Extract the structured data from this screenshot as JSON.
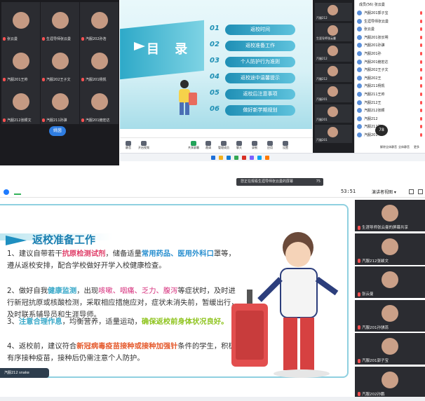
{
  "top": {
    "gallery": [
      {
        "name": "张云曼",
        "row": 0,
        "col": 0
      },
      {
        "name": "生涯导师张云曼",
        "row": 0,
        "col": 1
      },
      {
        "name": "汽服202孙浩",
        "row": 0,
        "col": 2
      },
      {
        "name": "汽服201王帅",
        "row": 1,
        "col": 0
      },
      {
        "name": "汽服202王子文",
        "row": 1,
        "col": 1
      },
      {
        "name": "汽服201杨凯",
        "row": 1,
        "col": 2
      },
      {
        "name": "汽服212张颖文",
        "row": 2,
        "col": 0
      },
      {
        "name": "汽服211孙骐",
        "row": 2,
        "col": 1
      },
      {
        "name": "汽服201鲍宏达",
        "row": 2,
        "col": 2
      }
    ],
    "gallery_center_badge": "姚茵",
    "slide": {
      "title": "目 录",
      "items": [
        {
          "num": "01",
          "label": "返校时间"
        },
        {
          "num": "02",
          "label": "返校准备工作"
        },
        {
          "num": "03",
          "label": "个人防护行为准则"
        },
        {
          "num": "04",
          "label": "返校途中温馨提示"
        },
        {
          "num": "05",
          "label": "返校后注意事项"
        },
        {
          "num": "06",
          "label": "做好新学期规划"
        }
      ]
    },
    "toolbar": [
      {
        "label": "静音"
      },
      {
        "label": "开启视频"
      },
      {
        "label": "共享屏幕"
      },
      {
        "label": "邀请"
      },
      {
        "label": "管理成员"
      },
      {
        "label": "聊天"
      },
      {
        "label": "录制"
      },
      {
        "label": "应用"
      },
      {
        "label": "设置"
      }
    ],
    "stop_share": "停止共享",
    "video_column": [
      {
        "name": "汽服212"
      },
      {
        "name": "生涯导师张云曼"
      },
      {
        "name": "汽服212"
      },
      {
        "name": "汽服212"
      },
      {
        "name": "汽服201"
      },
      {
        "name": "汽服201"
      },
      {
        "name": "汽服201"
      }
    ],
    "participants_header": "成员(56)  张云曼",
    "participants": [
      "汽服201郭子宝",
      "生涯导师张云曼",
      "张云曼",
      "汽服201张长明",
      "汽服201孙骐",
      "汽服201孙",
      "汽服201鲍宏达",
      "汽服202王子文",
      "汽服202王",
      "汽服211杨凯",
      "汽服211王帅",
      "汽服212王",
      "汽服212张颖",
      "汽服212",
      "汽服212张",
      "汽服201"
    ],
    "participant_buttons": [
      "解除全体静音",
      "全体静音",
      "更多"
    ],
    "badge_count": "78"
  },
  "bottom": {
    "banner_text": "您正在观看生涯导师张云曼的屏幕",
    "banner_num": "75",
    "timer": "53:51",
    "view_mode": "演讲者视图 ▾",
    "slide": {
      "title": "返校准备工作",
      "paragraphs": [
        {
          "segments": [
            {
              "t": "1、建议自带若干",
              "c": ""
            },
            {
              "t": "抗原检测试剂",
              "c": "hl-r"
            },
            {
              "t": "，储备适量",
              "c": ""
            },
            {
              "t": "常用药品、医用外科口",
              "c": "hl-b"
            },
            {
              "t": "罩等，遵从返校安排，配合学校做好开学入校健康检查。",
              "c": ""
            }
          ]
        },
        {
          "segments": [
            {
              "t": "2、做好自我",
              "c": ""
            },
            {
              "t": "健康监测",
              "c": "hl-g"
            },
            {
              "t": "，出现",
              "c": ""
            },
            {
              "t": "咳嗽、咽痛、乏力、腹泻",
              "c": "hl-p"
            },
            {
              "t": "等症状时，及时进行新冠抗原或核酸检测，采取相应措施应对，症状未消失前，暂缓出行，及时联系辅导员和生涯导师。",
              "c": ""
            }
          ]
        },
        {
          "segments": [
            {
              "t": "3、",
              "c": ""
            },
            {
              "t": "注意合理作息",
              "c": "hl-g"
            },
            {
              "t": "，均衡营养，适量运动，",
              "c": ""
            },
            {
              "t": "确保返校前身体状况良好。",
              "c": "hl-gr"
            }
          ]
        },
        {
          "segments": [
            {
              "t": "4、返校前，建议符合",
              "c": ""
            },
            {
              "t": "新冠病毒疫苗接种或接种加强针",
              "c": "hl-o"
            },
            {
              "t": "条件的学生，积极有序接种疫苗，接种后仍需注意个人防护。",
              "c": ""
            }
          ]
        }
      ],
      "footer": "汽服212 snake"
    },
    "video_column": [
      {
        "name": "生涯导师张云曼的屏幕共享"
      },
      {
        "name": "汽服212张颖文"
      },
      {
        "name": "张云曼"
      },
      {
        "name": "汽服201孙骐蕊"
      },
      {
        "name": "汽服201郭子宝"
      },
      {
        "name": "汽服202孙鹏"
      }
    ]
  },
  "colors": {
    "accent_blue": "#1a7fb1",
    "highlight_red": "#e0406a",
    "highlight_orange": "#e55a2d",
    "highlight_green": "#8fc41f",
    "mic_red": "#ff5252"
  }
}
